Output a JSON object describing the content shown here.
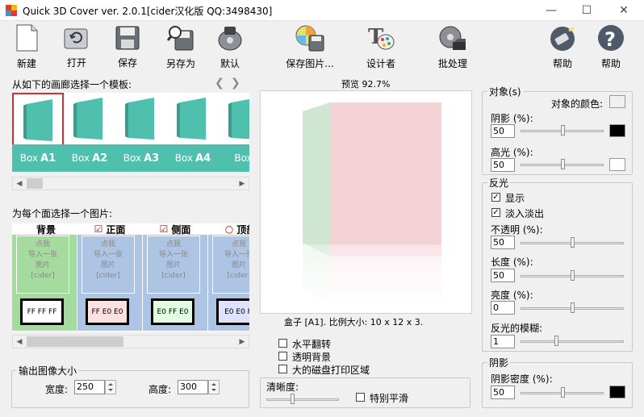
{
  "window": {
    "title": "Quick 3D Cover ver. 2.0.1[cider汉化版 QQ:3498430]",
    "minimize_glyph": "—",
    "maximize_glyph": "☐",
    "close_glyph": "✕"
  },
  "toolbar": {
    "new": "新建",
    "open": "打开",
    "save": "保存",
    "save_as": "另存为",
    "default": "默认",
    "save_image": "保存图片...",
    "designer": "设计者",
    "batch": "批处理",
    "help1": "帮助",
    "help2": "帮助"
  },
  "gallery": {
    "heading": "从如下的画廊选择一个模板:",
    "items": [
      {
        "prefix": "Box",
        "code": "A1"
      },
      {
        "prefix": "Box",
        "code": "A2"
      },
      {
        "prefix": "Box",
        "code": "A3"
      },
      {
        "prefix": "Box",
        "code": "A4"
      },
      {
        "prefix": "Box",
        "code": ""
      }
    ],
    "accent_color": "#4fbfae",
    "selected_border": "#d03030"
  },
  "faces": {
    "heading": "为每个面选择一个图片:",
    "drop_text": [
      "点我",
      "导入一张",
      "图片",
      "[cider]"
    ],
    "items": [
      {
        "label": "背景",
        "mark": "",
        "color": "FF FF FF",
        "bg": "#a6dba0",
        "swatch": "#ffffff"
      },
      {
        "label": "正面",
        "mark": "☑",
        "color": "FF E0 E0",
        "bg": "#aec4e4",
        "swatch": "#ffe0e0"
      },
      {
        "label": "侧面",
        "mark": "☑",
        "color": "E0 FF E0",
        "bg": "#aec4e4",
        "swatch": "#e0ffe0"
      },
      {
        "label": "顶部",
        "mark": "○",
        "color": "E0 E0 F",
        "bg": "#aec4e4",
        "swatch": "#e0e0ff"
      }
    ]
  },
  "output_size": {
    "title": "输出图像大小",
    "width_label": "宽度:",
    "width": "250",
    "height_label": "高度:",
    "height": "300"
  },
  "preview": {
    "label": "预览 92.7%",
    "info": "盒子 [A1]. 比例大小: 10 x 12 x 3.",
    "front_color": "#f4d3d6",
    "side_color": "#cfe6d2"
  },
  "options": {
    "flip_h": "水平翻转",
    "transparent": "透明背景",
    "large_print": "大的磁盘打印区域",
    "sharpness": "清晰度:",
    "smooth": "特别平滑"
  },
  "object": {
    "title": "对象(s)",
    "color_label": "对象的颜色:",
    "shadow_label": "阴影 (%):",
    "shadow_value": "50",
    "highlight_label": "高光 (%):",
    "highlight_value": "50",
    "shadow_color": "#000000",
    "highlight_color": "#ffffff"
  },
  "reflection": {
    "title": "反光",
    "show": "显示",
    "fade": "淡入淡出",
    "opacity_label": "不透明 (%):",
    "opacity_value": "50",
    "length_label": "长度 (%):",
    "length_value": "50",
    "brightness_label": "亮度 (%):",
    "brightness_value": "0",
    "blur_label": "反光的模糊:",
    "blur_value": "1"
  },
  "shadow": {
    "title": "阴影",
    "density_label": "阴影密度 (%):",
    "density_value": "50",
    "color": "#000000"
  }
}
